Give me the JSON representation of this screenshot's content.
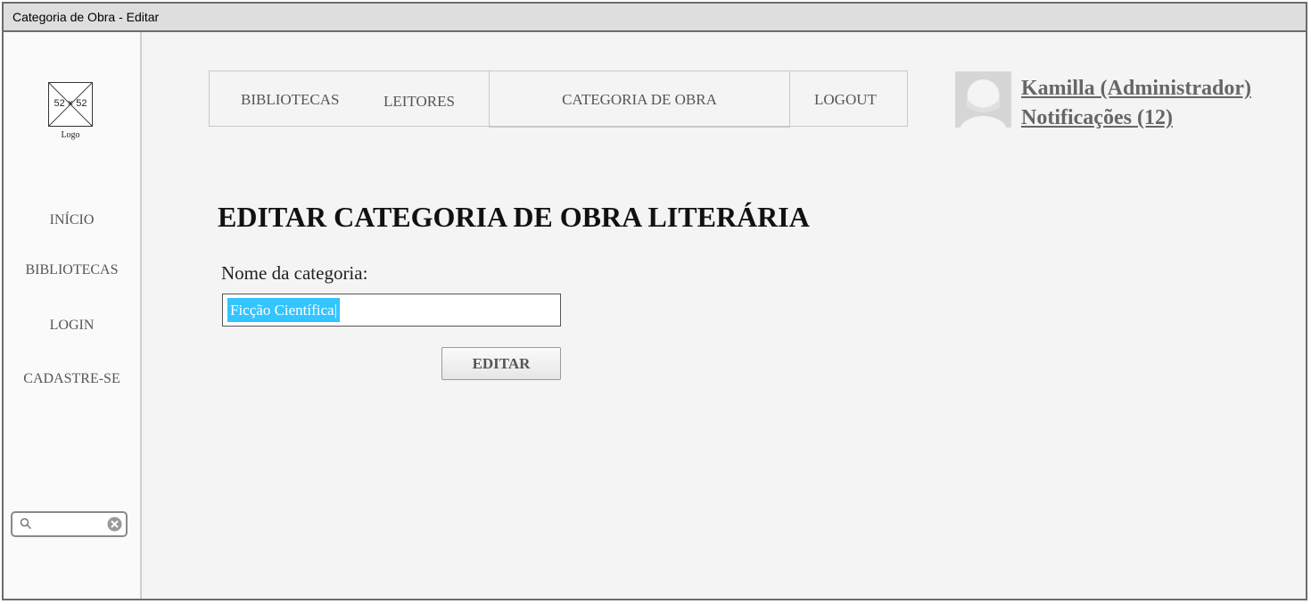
{
  "window": {
    "title": "Categoria de Obra - Editar"
  },
  "sidebar": {
    "logo": {
      "size_text": "52 × 52",
      "label": "Logo"
    },
    "items": [
      {
        "label": "INÍCIO"
      },
      {
        "label": "BIBLIOTECAS"
      },
      {
        "label": "LOGIN"
      },
      {
        "label": "CADASTRE-SE"
      }
    ],
    "search": {
      "value": ""
    }
  },
  "nav": {
    "items": [
      {
        "label": "BIBLIOTECAS"
      },
      {
        "label": "LEITORES"
      },
      {
        "label": "CATEGORIA DE OBRA",
        "active": true
      },
      {
        "label": "LOGOUT"
      }
    ]
  },
  "user": {
    "name": "Kamilla (Administrador)",
    "notifications": "Notificações (12)"
  },
  "page": {
    "title": "EDITAR CATEGORIA DE OBRA LITERÁRIA",
    "field_label": "Nome da categoria:",
    "field_value": "Ficção Científica|",
    "submit_label": "EDITAR"
  },
  "colors": {
    "selection": "#33c5ff",
    "border": "#6b6b6b",
    "background": "#f4f4f4"
  },
  "icons": [
    "search-icon",
    "clear-icon",
    "avatar-icon",
    "image-placeholder-icon"
  ]
}
